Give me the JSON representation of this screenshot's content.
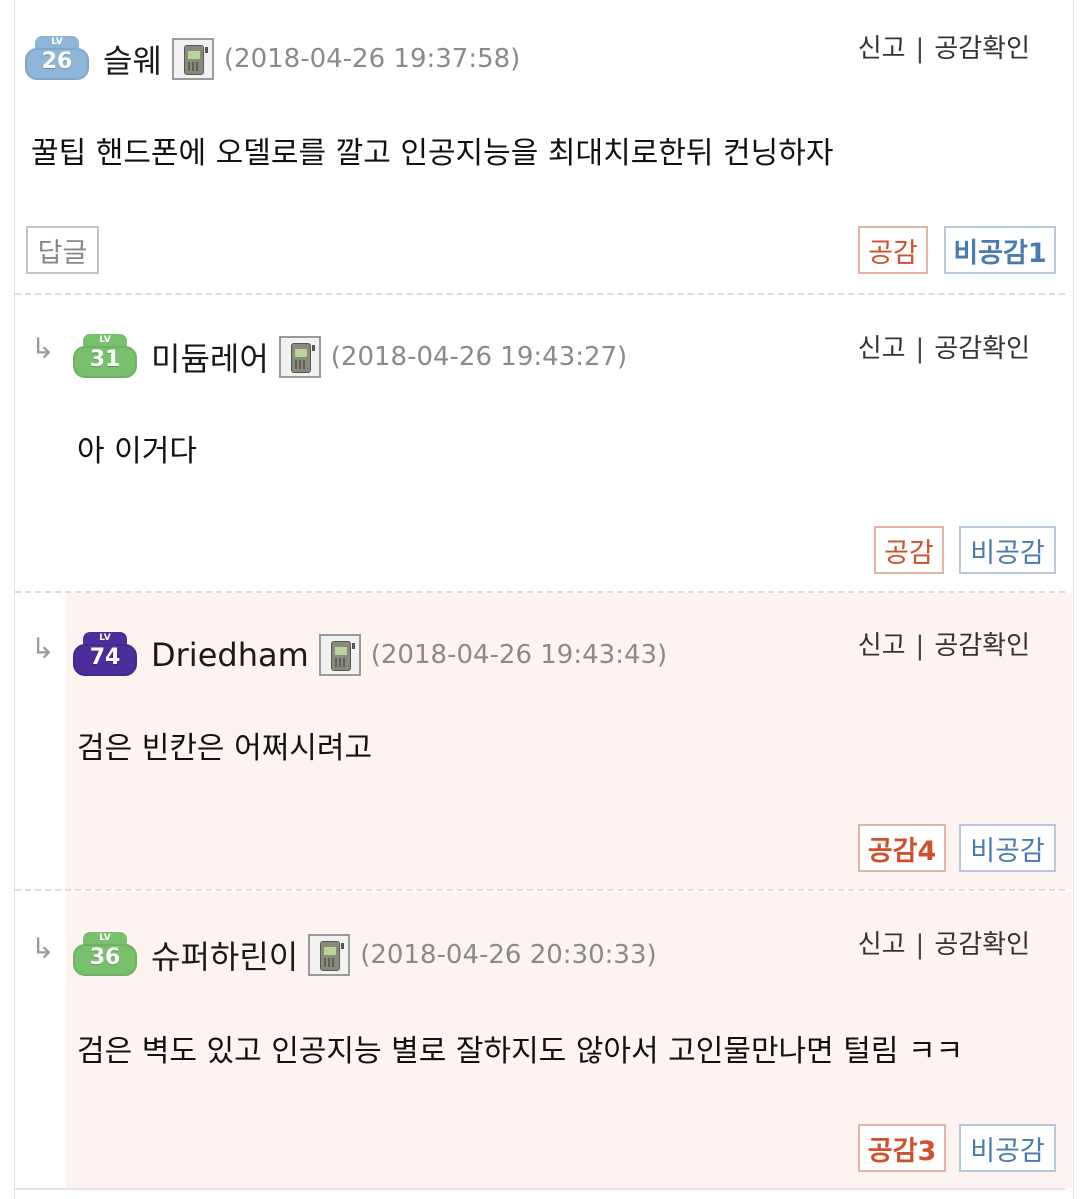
{
  "comments": [
    {
      "level": "26",
      "level_cap": "LV",
      "nickname": "슬웨",
      "timestamp": "(2018-04-26 19:37:58)",
      "report": "신고",
      "separator": "|",
      "check": "공감확인",
      "text": "꿀팁 핸드폰에 오델로를 깔고 인공지능을 최대치로한뒤 컨닝하자",
      "reply_label": "답글",
      "like_label": "공감",
      "dislike_label": "비공감1"
    },
    {
      "level": "31",
      "level_cap": "LV",
      "nickname": "미듐레어",
      "timestamp": "(2018-04-26 19:43:27)",
      "report": "신고",
      "separator": "|",
      "check": "공감확인",
      "text": "아 이거다",
      "like_label": "공감",
      "dislike_label": "비공감"
    },
    {
      "level": "74",
      "level_cap": "LV",
      "nickname": "Driedham",
      "timestamp": "(2018-04-26 19:43:43)",
      "report": "신고",
      "separator": "|",
      "check": "공감확인",
      "text": "검은 빈칸은 어쩌시려고",
      "like_label": "공감4",
      "dislike_label": "비공감"
    },
    {
      "level": "36",
      "level_cap": "LV",
      "nickname": "슈퍼하린이",
      "timestamp": "(2018-04-26 20:30:33)",
      "report": "신고",
      "separator": "|",
      "check": "공감확인",
      "text": "검은 벽도 있고 인공지능 별로 잘하지도 않아서 고인물만나면 털림 ㅋㅋ",
      "like_label": "공감3",
      "dislike_label": "비공감"
    }
  ],
  "reply_arrow": "↳",
  "icons": [
    "level-badge-icon",
    "mobile-phone-icon",
    "reply-arrow-icon"
  ],
  "colors": {
    "like": "#d0502c",
    "dislike": "#4a7aae",
    "highlight_bg": "#fdf3f0",
    "timestamp": "#8a8a8a"
  }
}
